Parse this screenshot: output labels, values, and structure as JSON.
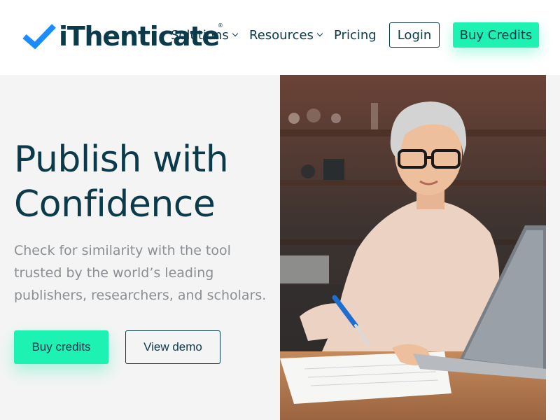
{
  "brand": {
    "name": "iThenticate",
    "registered": "®",
    "check_color": "#1a8cff",
    "text_color": "#0b3a4a"
  },
  "nav": {
    "solutions_label": "Solutions",
    "resources_label": "Resources",
    "pricing_label": "Pricing",
    "login_label": "Login",
    "buy_credits_label": "Buy Credits"
  },
  "hero": {
    "title_line1": "Publish with",
    "title_line2": "Confidence",
    "subtitle": "Check for similarity with the tool trusted by the world’s leading publishers, researchers, and scholars.",
    "buy_label": "Buy credits",
    "demo_label": "View demo"
  },
  "colors": {
    "accent": "#1ef2b3",
    "navy": "#0b3a4a",
    "subtitle_gray": "#8a8f94",
    "background": "#f4f4f4"
  }
}
